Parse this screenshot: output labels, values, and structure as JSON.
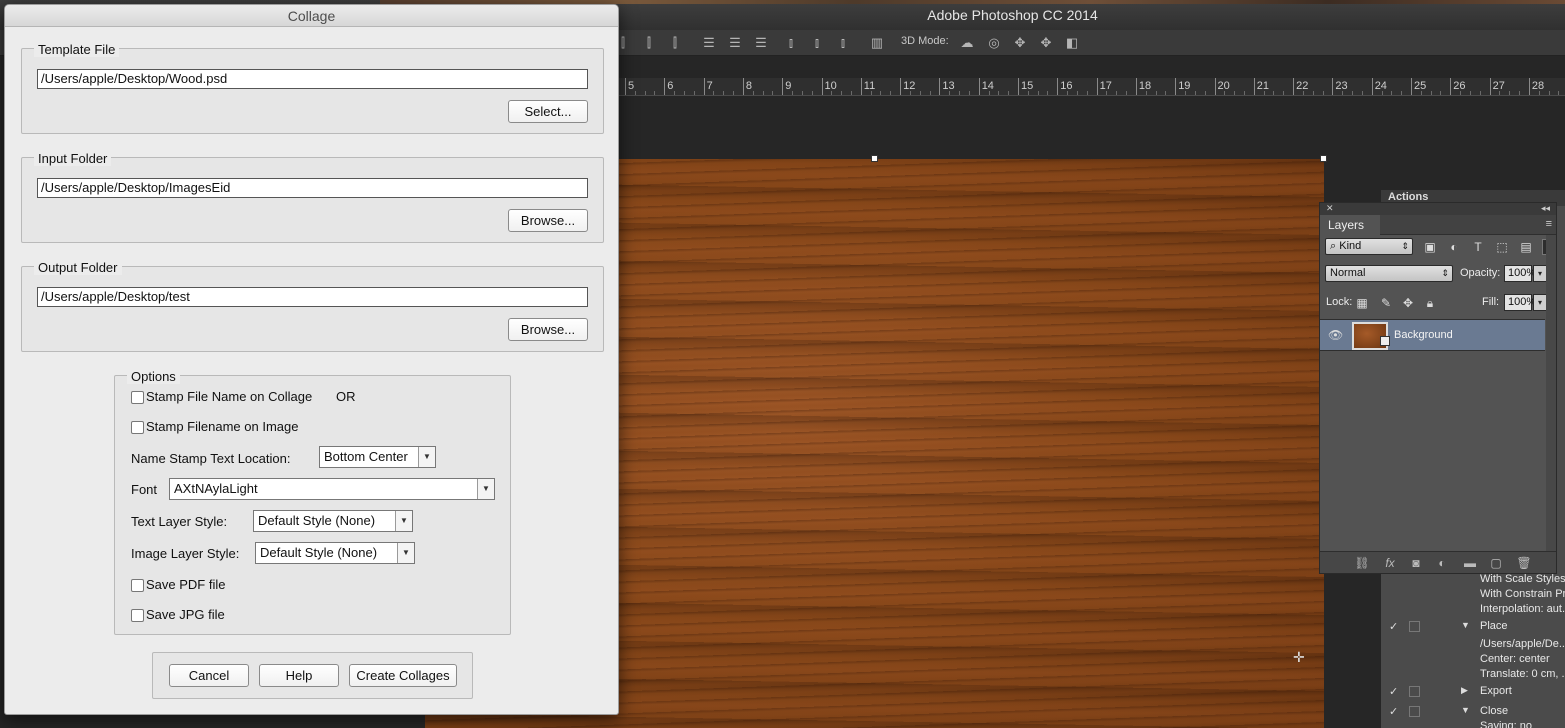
{
  "photoshop": {
    "title": "Adobe Photoshop CC 2014",
    "options_bar": {
      "mode_label": "3D Mode:"
    },
    "ruler": {
      "ticks": [
        "5",
        "6",
        "7",
        "8",
        "9",
        "10",
        "11",
        "12",
        "13",
        "14",
        "15",
        "16",
        "17",
        "18",
        "19",
        "20",
        "21",
        "22",
        "23",
        "24",
        "25",
        "26",
        "27",
        "28"
      ]
    },
    "actions": {
      "tab": "Actions",
      "rows": [
        {
          "check": "",
          "tri": "",
          "text": "With Scale Styles"
        },
        {
          "check": "",
          "tri": "",
          "text": "With Constrain Pr..."
        },
        {
          "check": "",
          "tri": "",
          "text": "Interpolation: aut..."
        },
        {
          "check": "✓",
          "tri": "▼",
          "text": "Place"
        },
        {
          "check": "",
          "tri": "",
          "text": "/Users/apple/De..."
        },
        {
          "check": "",
          "tri": "",
          "text": "Center: center"
        },
        {
          "check": "",
          "tri": "",
          "text": "Translate: 0 cm, ..."
        },
        {
          "check": "✓",
          "tri": "▶",
          "text": "Export"
        },
        {
          "check": "✓",
          "tri": "▼",
          "text": "Close"
        },
        {
          "check": "",
          "tri": "",
          "text": "Saving: no"
        }
      ]
    },
    "layers": {
      "tab": "Layers",
      "filter_kind": "Kind",
      "blend_mode": "Normal",
      "opacity_label": "Opacity:",
      "opacity_value": "100%",
      "lock_label": "Lock:",
      "fill_label": "Fill:",
      "fill_value": "100%",
      "layer_name": "Background"
    }
  },
  "dialog": {
    "title": "Collage",
    "template": {
      "label": "Template File",
      "path": "/Users/apple/Desktop/Wood.psd",
      "button": "Select..."
    },
    "input": {
      "label": "Input Folder",
      "path": "/Users/apple/Desktop/ImagesEid",
      "button": "Browse..."
    },
    "output": {
      "label": "Output Folder",
      "path": "/Users/apple/Desktop/test",
      "button": "Browse..."
    },
    "options": {
      "label": "Options",
      "stamp_collage": "Stamp File Name on Collage",
      "or_text": "OR",
      "stamp_image": "Stamp Filename on Image",
      "name_stamp_label": "Name Stamp Text  Location:",
      "location_value": "Bottom Center",
      "font_label": "Font",
      "font_value": "AXtNAylaLight",
      "text_style_label": "Text Layer Style:",
      "text_style_value": "Default Style (None)",
      "image_style_label": "Image Layer Style:",
      "image_style_value": "Default Style (None)",
      "save_pdf": "Save PDF file",
      "save_jpg": "Save JPG file"
    },
    "buttons": {
      "cancel": "Cancel",
      "help": "Help",
      "create": "Create Collages"
    }
  }
}
